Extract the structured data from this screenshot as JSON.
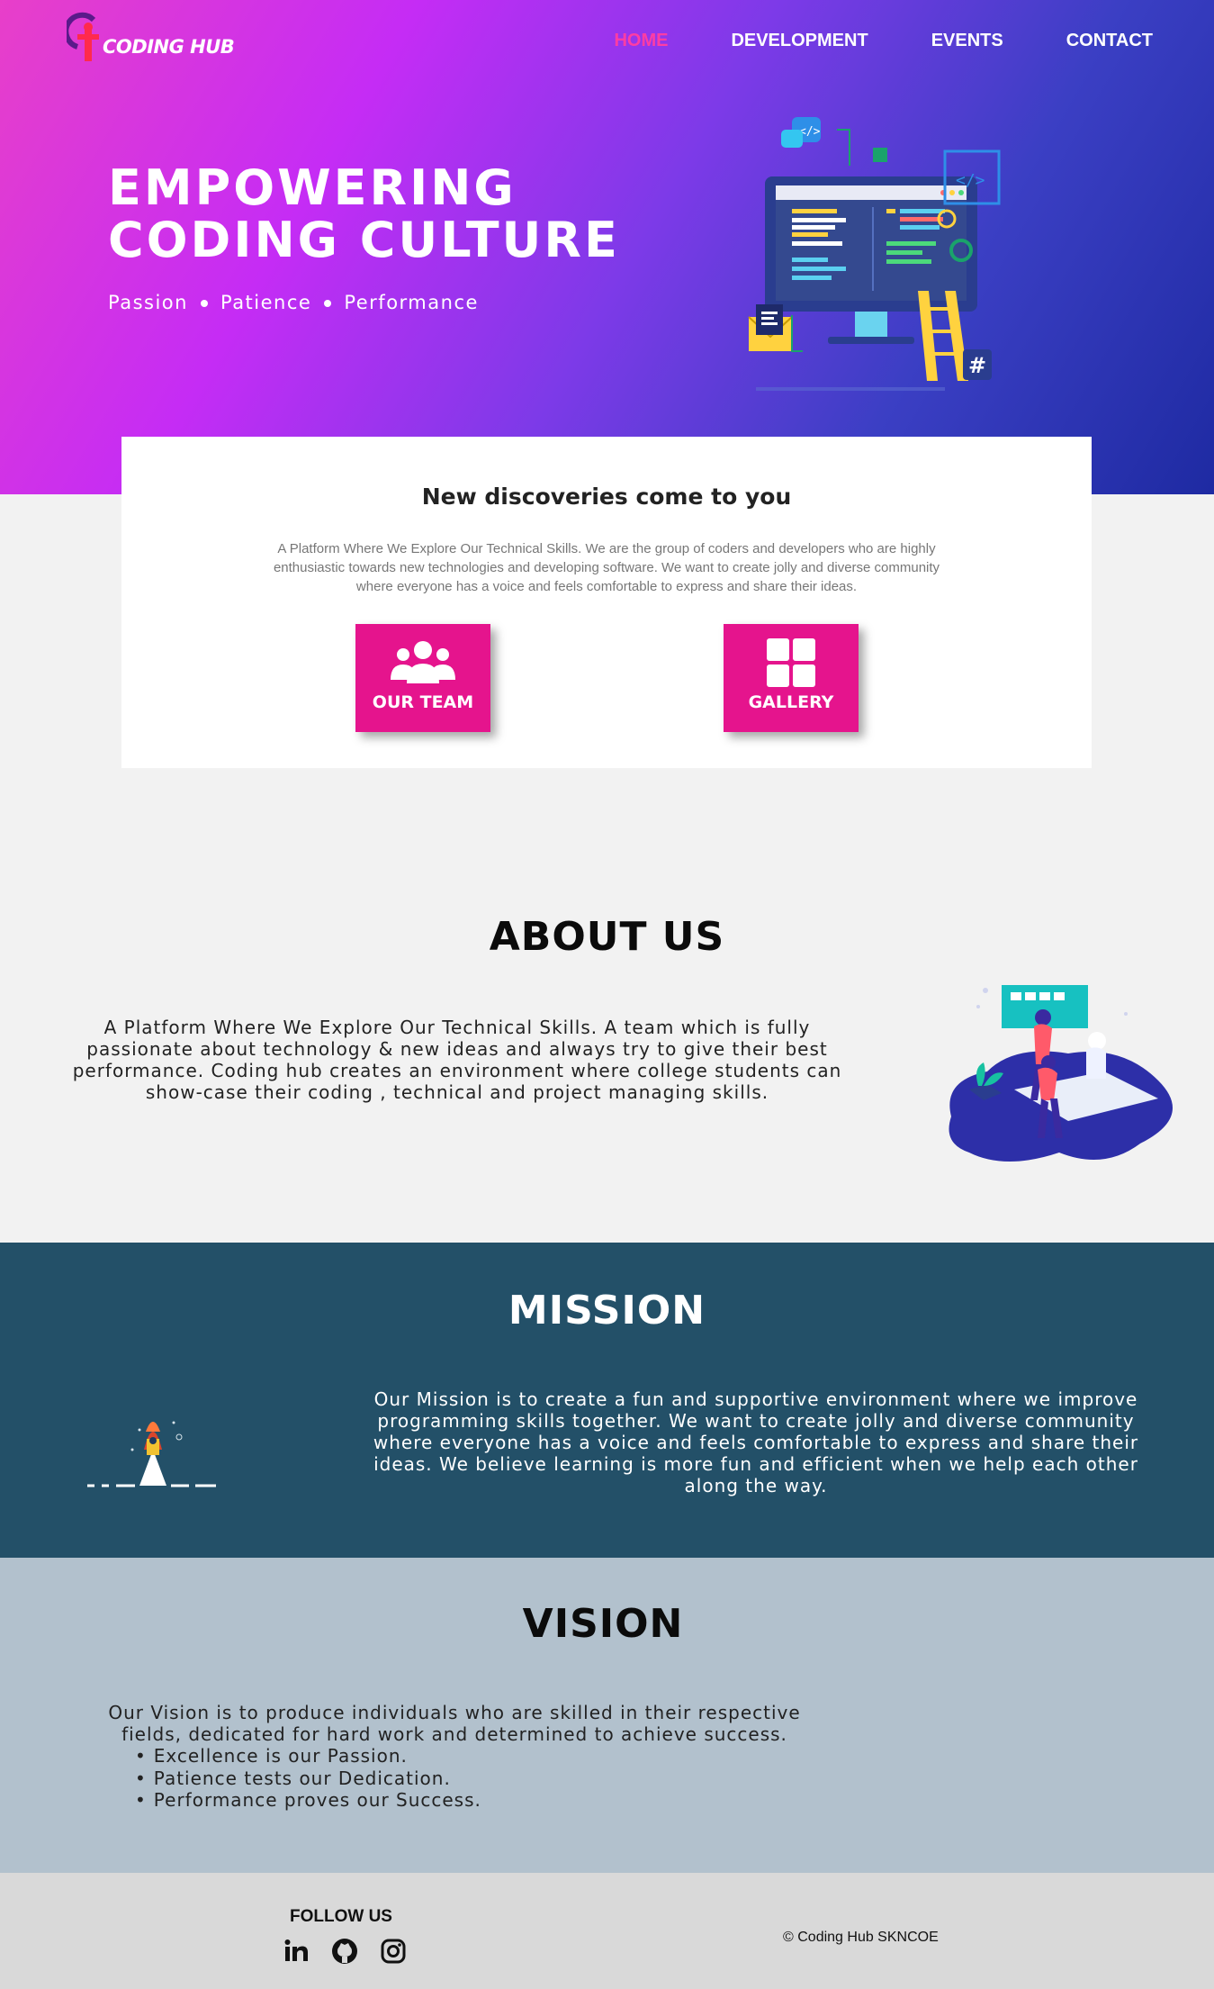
{
  "header": {
    "logo_text": "CODING HUB",
    "nav": [
      {
        "label": "HOME",
        "active": true
      },
      {
        "label": "DEVELOPMENT",
        "active": false
      },
      {
        "label": "EVENTS",
        "active": false
      },
      {
        "label": "CONTACT",
        "active": false
      }
    ]
  },
  "hero": {
    "title_line1": "EMPOWERING",
    "title_line2": "CODING CULTURE",
    "tagline": [
      "Passion",
      "Patience",
      "Performance"
    ]
  },
  "intro": {
    "title": "New discoveries come to you",
    "text": "A Platform Where We Explore Our Technical Skills. We are the group of coders and developers who are highly enthusiastic towards new technologies and developing software. We want to create jolly and diverse community where everyone has a voice and feels comfortable to express and share their ideas.",
    "buttons": [
      {
        "label": "OUR TEAM",
        "icon": "users-icon"
      },
      {
        "label": "GALLERY",
        "icon": "grid-icon"
      }
    ]
  },
  "about": {
    "title": "ABOUT US",
    "text": "A Platform Where We Explore Our Technical Skills. A team which is fully passionate about technology & new ideas and always try to give their best performance. Coding hub creates an environment where college students can show-case their coding , technical and project managing skills."
  },
  "mission": {
    "title": "MISSION",
    "text": "Our Mission is to create a fun and supportive environment where we improve programming skills together. We want to create jolly and diverse community where everyone has a voice and feels comfortable to express and share their ideas. We believe learning is more fun and efficient when we help each other along the way."
  },
  "vision": {
    "title": "VISION",
    "text": "Our Vision is to produce individuals who are skilled in their respective fields, dedicated for hard work and determined to achieve success.",
    "points": [
      "Excellence is our Passion.",
      "Patience tests our Dedication.",
      "Performance proves our Success."
    ]
  },
  "footer": {
    "follow_label": "FOLLOW US",
    "socials": [
      "linkedin-icon",
      "github-icon",
      "instagram-icon"
    ],
    "copyright": "© Coding Hub SKNCOE"
  },
  "colors": {
    "accent": "#e5148d",
    "nav_active": "#ff3da3",
    "mission_bg": "#235068",
    "vision_bg": "#b2c1cd",
    "footer_bg": "#d9d9d9"
  }
}
